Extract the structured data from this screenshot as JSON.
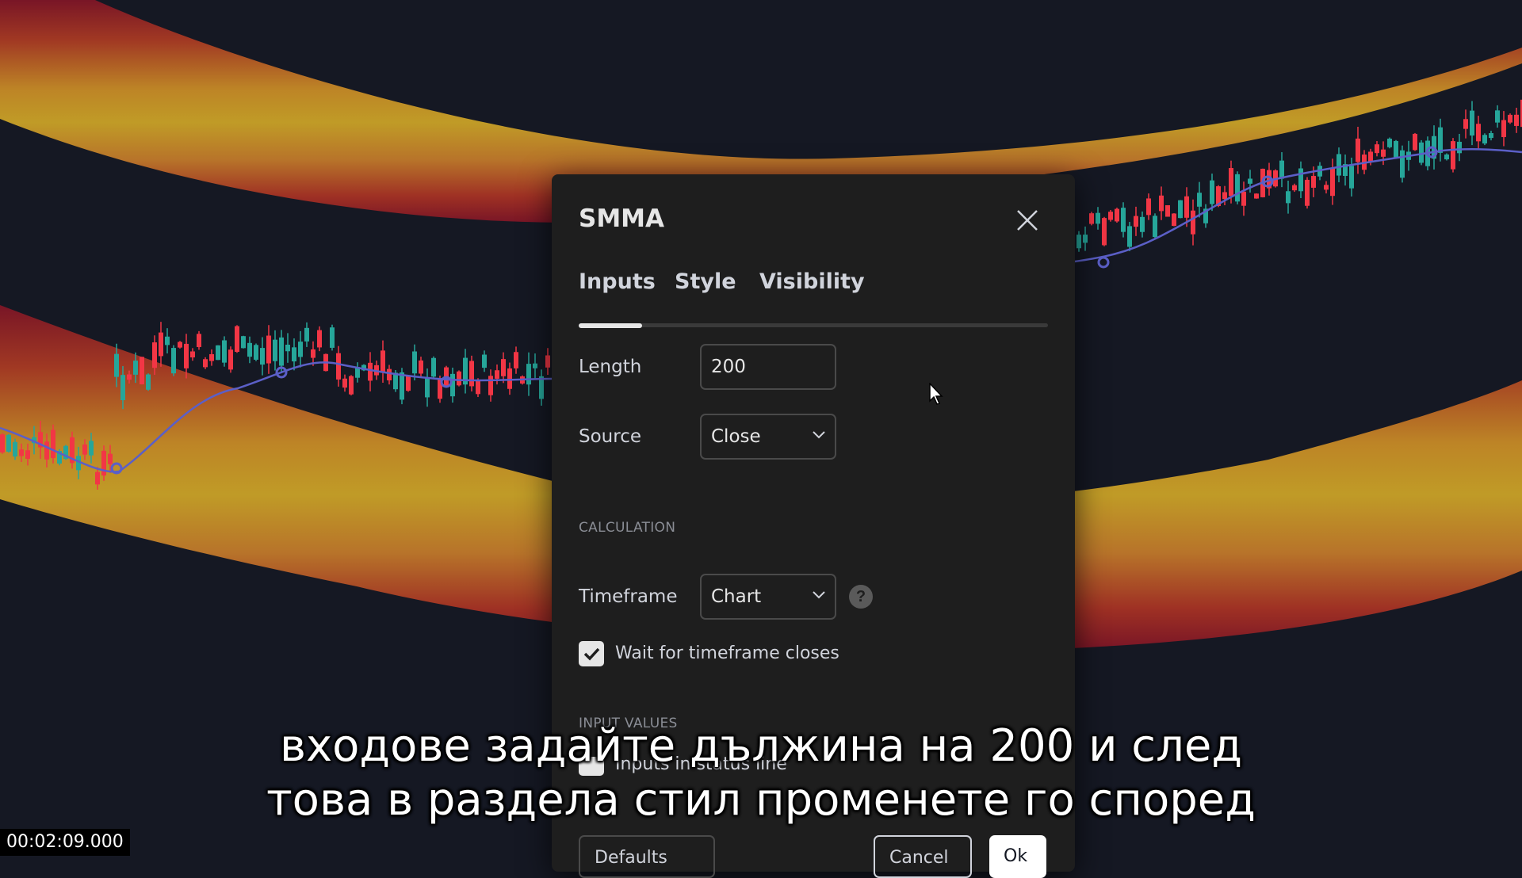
{
  "dialog": {
    "title": "SMMA",
    "tabs": [
      {
        "label": "Inputs",
        "active": true
      },
      {
        "label": "Style",
        "active": false
      },
      {
        "label": "Visibility",
        "active": false
      }
    ],
    "inputs": {
      "length_label": "Length",
      "length_value": "200",
      "source_label": "Source",
      "source_value": "Close"
    },
    "calculation": {
      "section_title": "CALCULATION",
      "timeframe_label": "Timeframe",
      "timeframe_value": "Chart",
      "help_icon": "question-icon",
      "wait_label": "Wait for timeframe closes",
      "wait_checked": true
    },
    "input_values": {
      "section_title": "INPUT VALUES",
      "checkbox_label": "Inputs in status line"
    },
    "buttons": {
      "defaults": "Defaults",
      "cancel": "Cancel",
      "ok": "Ok"
    }
  },
  "subtitle": {
    "line1": "входове задайте дължина на 200 и след",
    "line2": "това в раздела стил променете го според"
  },
  "timecode": "00:02:09.000",
  "colors": {
    "background": "#151823",
    "band_outer": "#8b1a2b",
    "band_inner": "#c9a227",
    "candle_up": "#26a69a",
    "candle_down": "#f23645",
    "smma_line": "#5b5fc7",
    "dialog_bg": "#1e1e1e"
  }
}
